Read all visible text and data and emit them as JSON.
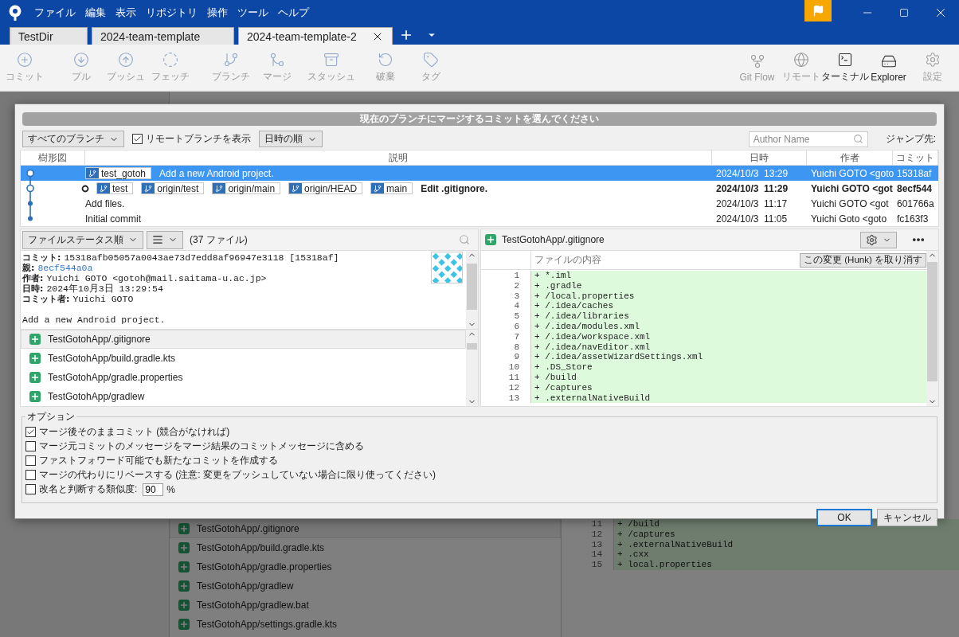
{
  "menu": [
    "ファイル",
    "編集",
    "表示",
    "リポジトリ",
    "操作",
    "ツール",
    "ヘルプ"
  ],
  "tabs": [
    {
      "label": "TestDir",
      "selected": false
    },
    {
      "label": "2024-team-template",
      "selected": false
    },
    {
      "label": "2024-team-template-2",
      "selected": true
    }
  ],
  "toolbar": {
    "left": [
      {
        "label": "コミット",
        "disabled": true
      },
      {
        "label": "プル",
        "disabled": true
      },
      {
        "label": "プッシュ",
        "disabled": true
      },
      {
        "label": "フェッチ",
        "disabled": true
      },
      {
        "label": "ブランチ",
        "disabled": true
      },
      {
        "label": "マージ",
        "disabled": true
      },
      {
        "label": "スタッシュ",
        "disabled": true
      },
      {
        "label": "破棄",
        "disabled": true
      },
      {
        "label": "タグ",
        "disabled": true
      }
    ],
    "right": [
      {
        "label": "Git Flow",
        "disabled": true
      },
      {
        "label": "リモート",
        "disabled": true
      },
      {
        "label": "ターミナル",
        "disabled": false
      },
      {
        "label": "Explorer",
        "disabled": false
      },
      {
        "label": "設定",
        "disabled": true
      }
    ]
  },
  "background": {
    "files": [
      {
        "name": "TestGotohApp/.gitignore",
        "selected": true
      },
      {
        "name": "TestGotohApp/build.gradle.kts",
        "selected": false
      },
      {
        "name": "TestGotohApp/gradle.properties",
        "selected": false
      },
      {
        "name": "TestGotohApp/gradlew",
        "selected": false
      },
      {
        "name": "TestGotohApp/gradlew.bat",
        "selected": false
      },
      {
        "name": "TestGotohApp/settings.gradle.kts",
        "selected": false
      }
    ],
    "diff_lines": [
      {
        "no": "11",
        "text": "+ /build"
      },
      {
        "no": "12",
        "text": "+ /captures"
      },
      {
        "no": "13",
        "text": "+ .externalNativeBuild"
      },
      {
        "no": "14",
        "text": "+ .cxx"
      },
      {
        "no": "15",
        "text": "+ local.properties"
      }
    ]
  },
  "dialog": {
    "title": "現在のブランチにマージするコミットを選んでください",
    "filters": {
      "branches": "すべてのブランチ",
      "show_remote": {
        "label": "リモートブランチを表示",
        "checked": true
      },
      "sort": "日時の順",
      "author_placeholder": "Author Name",
      "jump_label": "ジャンプ先:"
    },
    "columns": [
      "樹形図",
      "説明",
      "日時",
      "作者",
      "コミット"
    ],
    "commits": [
      {
        "current": false,
        "selected": true,
        "refs": [
          "test_gotoh"
        ],
        "message": "Add a new Android project.",
        "date": "2024/10/3  13:29",
        "author": "Yuichi GOTO <goto",
        "hash": "15318af"
      },
      {
        "current": true,
        "selected": false,
        "refs": [
          "test",
          "origin/test",
          "origin/main",
          "origin/HEAD",
          "main"
        ],
        "message": "Edit .gitignore.",
        "date": "2024/10/3  11:29",
        "author": "Yuichi GOTO <got",
        "hash": "8ecf544"
      },
      {
        "current": false,
        "selected": false,
        "message": "Add files.",
        "date": "2024/10/3  11:17",
        "author": "Yuichi GOTO <got",
        "hash": "601766a"
      },
      {
        "current": false,
        "selected": false,
        "message": "Initial commit",
        "date": "2024/10/3  11:05",
        "author": "Yuichi Goto <goto",
        "hash": "fc163f3"
      }
    ],
    "file_sort": "ファイルステータス順",
    "file_count": "(37 ファイル)",
    "commit_info": [
      {
        "label": "コミット:",
        "value": "15318afb05057a0043ae73d7edd8af96947e3118 [15318af]",
        "link": false
      },
      {
        "label": "親:",
        "value": "8ecf544a0a",
        "link": true
      },
      {
        "label": "作者:",
        "value": "Yuichi GOTO <gotoh@mail.saitama-u.ac.jp>",
        "link": false
      },
      {
        "label": "日時:",
        "value": "2024年10月3日 13:29:54",
        "link": false
      },
      {
        "label": "コミット者:",
        "value": "Yuichi GOTO",
        "link": false
      }
    ],
    "commit_message": "Add a new Android project.",
    "files": [
      {
        "name": "TestGotohApp/.gitignore",
        "selected": true
      },
      {
        "name": "TestGotohApp/build.gradle.kts",
        "selected": false
      },
      {
        "name": "TestGotohApp/gradle.properties",
        "selected": false
      },
      {
        "name": "TestGotohApp/gradlew",
        "selected": false
      }
    ],
    "diff": {
      "file": "TestGotohApp/.gitignore",
      "content_header": "ファイルの内容",
      "hunk_button": "この変更 (Hunk) を取り消す",
      "lines": [
        {
          "no": "1",
          "text": "+ *.iml"
        },
        {
          "no": "2",
          "text": "+ .gradle"
        },
        {
          "no": "3",
          "text": "+ /local.properties"
        },
        {
          "no": "4",
          "text": "+ /.idea/caches"
        },
        {
          "no": "5",
          "text": "+ /.idea/libraries"
        },
        {
          "no": "6",
          "text": "+ /.idea/modules.xml"
        },
        {
          "no": "7",
          "text": "+ /.idea/workspace.xml"
        },
        {
          "no": "8",
          "text": "+ /.idea/navEditor.xml"
        },
        {
          "no": "9",
          "text": "+ /.idea/assetWizardSettings.xml"
        },
        {
          "no": "10",
          "text": "+ .DS_Store"
        },
        {
          "no": "11",
          "text": "+ /build"
        },
        {
          "no": "12",
          "text": "+ /captures"
        },
        {
          "no": "13",
          "text": "+ .externalNativeBuild"
        }
      ]
    },
    "options": {
      "legend": "オプション",
      "items": [
        {
          "kind": "checkbox",
          "label": "マージ後そのままコミット (競合がなければ)",
          "checked": true
        },
        {
          "kind": "checkbox",
          "label": "マージ元コミットのメッセージをマージ結果のコミットメッセージに含める",
          "checked": false
        },
        {
          "kind": "checkbox",
          "label": "ファストフォワード可能でも新たなコミットを作成する",
          "checked": false
        },
        {
          "kind": "checkbox",
          "label": "マージの代わりにリベースする (注意: 変更をプッシュしていない場合に限り使ってください)",
          "checked": false
        },
        {
          "kind": "similarity",
          "label": "改名と判断する類似度:",
          "checked": false,
          "value": "90",
          "suffix": "%"
        }
      ]
    },
    "buttons": [
      "OK",
      "キャンセル"
    ]
  }
}
